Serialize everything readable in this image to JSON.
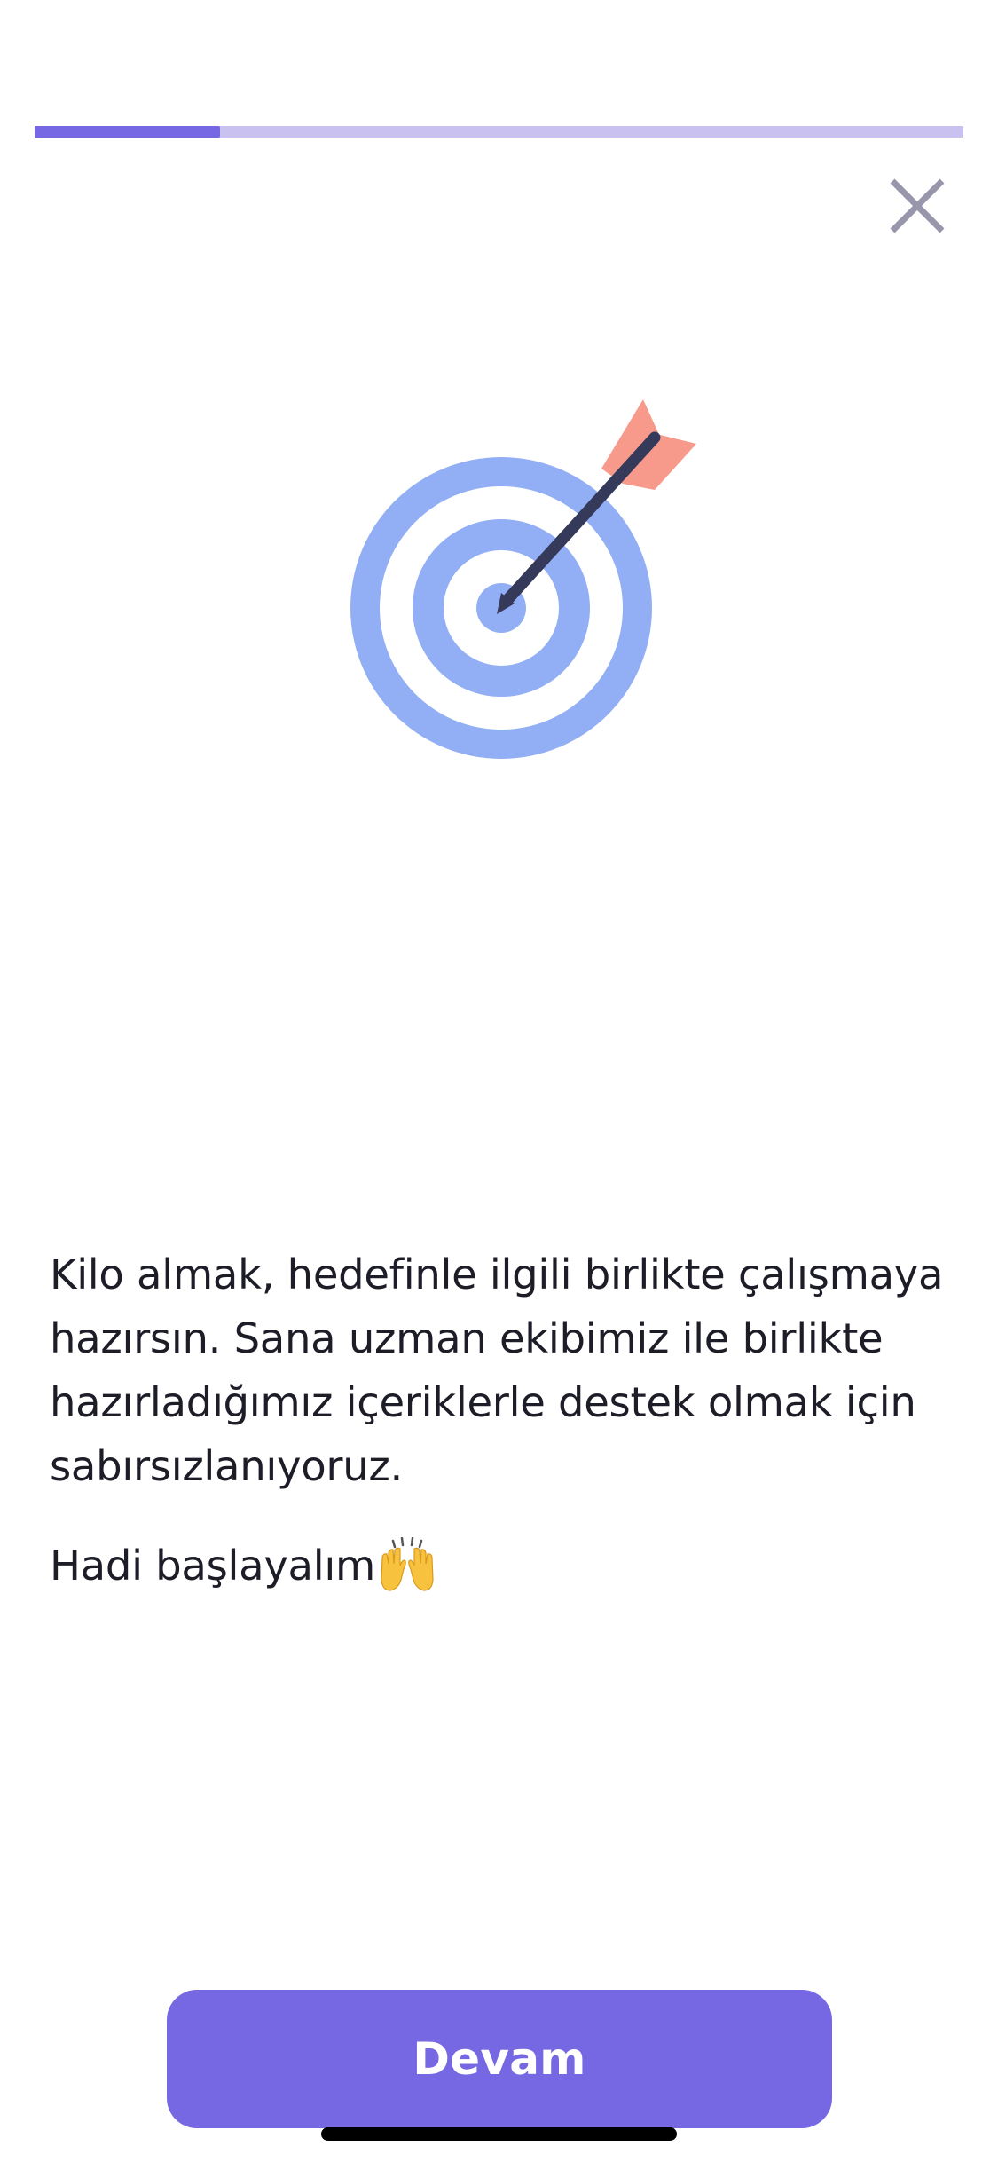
{
  "progress": {
    "fraction": 0.2
  },
  "header": {
    "close_icon": "close-icon"
  },
  "illustration": {
    "icon": "target-arrow-icon",
    "colors": {
      "rings": "#92aff6",
      "arrow_shaft": "#363a5a",
      "fletching": "#f79a8c"
    }
  },
  "content": {
    "paragraph": "Kilo almak, hedefinle ilgili birlikte çalışmaya hazırsın. Sana uzman ekibimiz ile birlikte hazırladığımız içeriklerle destek olmak için sabırsızlanıyoruz.",
    "cta_text": "Hadi başlayalım",
    "cta_emoji": "raising-hands-icon"
  },
  "footer": {
    "continue_label": "Devam"
  },
  "colors": {
    "accent": "#7667e2",
    "progress_track": "#c9c2f1",
    "close_icon": "#9896ac",
    "text": "#1d1d28"
  }
}
